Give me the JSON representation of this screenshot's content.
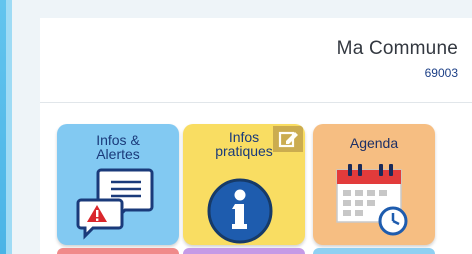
{
  "header": {
    "commune_name": "Ma Commune",
    "postal_code": "69003"
  },
  "tiles": [
    {
      "label": "Infos &\nAlertes",
      "color": "#82c9f2",
      "icon": "chat-alert-icon"
    },
    {
      "label": "Infos\npratiques",
      "color": "#f9dd62",
      "icon": "info-icon",
      "badge_icon": "edit-icon"
    },
    {
      "label": "Agenda",
      "color": "#f6be82",
      "icon": "calendar-clock-icon"
    }
  ],
  "colors": {
    "accent_blue": "#1c3f86",
    "strip": "#4ab4e6"
  }
}
